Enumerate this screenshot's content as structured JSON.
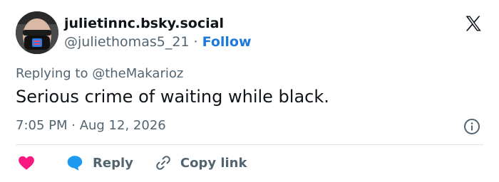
{
  "post": {
    "display_name": "julietinnc.bsky.social",
    "handle": "@juliethomas5_21",
    "separator": " · ",
    "follow_label": "Follow",
    "replying_to": "Replying to @theMakarioz",
    "text": "Serious crime of waiting while black.",
    "timestamp": "7:05 PM · Aug 12, 2026"
  },
  "actions": {
    "reply_label": "Reply",
    "copy_link_label": "Copy link"
  },
  "colors": {
    "accent": "#1d7ad9",
    "heart": "#f91880",
    "reply_icon": "#1d9bf0",
    "muted_text": "#536471",
    "primary_text": "#0f1419"
  },
  "icons": {
    "brand": "x-logo-icon",
    "info": "info-icon",
    "like": "heart-icon",
    "reply": "chat-bubble-icon",
    "copy": "link-icon"
  }
}
